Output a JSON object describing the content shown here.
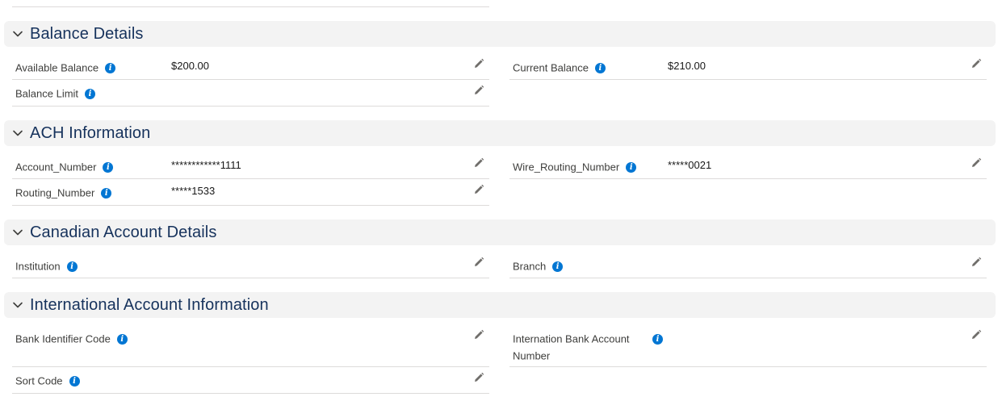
{
  "sections": {
    "balance": {
      "title": "Balance Details",
      "available_balance": {
        "label": "Available Balance",
        "value": "$200.00"
      },
      "current_balance": {
        "label": "Current Balance",
        "value": "$210.00"
      },
      "balance_limit": {
        "label": "Balance Limit",
        "value": ""
      }
    },
    "ach": {
      "title": "ACH Information",
      "account_number": {
        "label": "Account_Number",
        "value": "************1111"
      },
      "wire_routing_number": {
        "label": "Wire_Routing_Number",
        "value": "*****0021"
      },
      "routing_number": {
        "label": "Routing_Number",
        "value": "*****1533"
      }
    },
    "canadian": {
      "title": "Canadian Account Details",
      "institution": {
        "label": "Institution",
        "value": ""
      },
      "branch": {
        "label": "Branch",
        "value": ""
      }
    },
    "international": {
      "title": "International Account Information",
      "bank_identifier_code": {
        "label": "Bank Identifier Code",
        "value": ""
      },
      "iban": {
        "label": "Internation Bank Account Number",
        "value": ""
      },
      "sort_code": {
        "label": "Sort Code",
        "value": ""
      }
    }
  },
  "icons": {
    "info": "info-icon",
    "edit": "pencil-icon",
    "collapse": "chevron-down-icon"
  },
  "colors": {
    "section_bg": "#f3f3f3",
    "section_title": "#16325c",
    "info_icon": "#0176d3",
    "divider": "#dddbda"
  }
}
